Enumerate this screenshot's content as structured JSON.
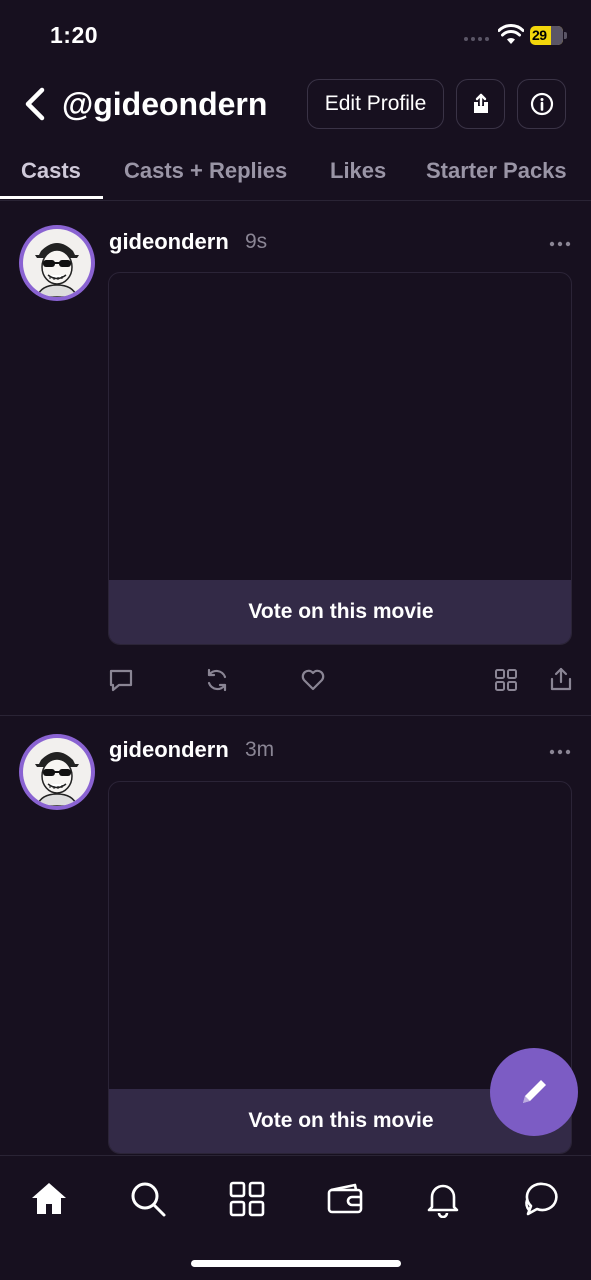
{
  "status_bar": {
    "time": "1:20",
    "battery": "29"
  },
  "header": {
    "handle": "@gideondern",
    "edit_profile_label": "Edit Profile",
    "icons": [
      "chevron-left-icon",
      "share-icon",
      "info-icon"
    ]
  },
  "tabs": [
    {
      "label": "Casts",
      "active": true
    },
    {
      "label": "Casts + Replies",
      "active": false
    },
    {
      "label": "Likes",
      "active": false
    },
    {
      "label": "Starter Packs",
      "active": false
    }
  ],
  "casts": [
    {
      "author": "gideondern",
      "time": "9s",
      "frame_button": "Vote on this movie"
    },
    {
      "author": "gideondern",
      "time": "3m",
      "frame_button": "Vote on this movie"
    }
  ],
  "bottom_nav": [
    "home-icon",
    "search-icon",
    "apps-grid-icon",
    "wallet-icon",
    "bell-icon",
    "chat-icon"
  ],
  "colors": {
    "background": "#17101f",
    "accent": "#7c5cc4",
    "frame_button_bg": "#332a47",
    "battery": "#f2d60b"
  }
}
